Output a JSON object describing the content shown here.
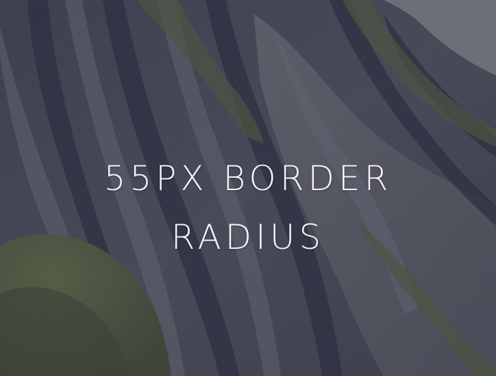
{
  "caption": {
    "line1": "55PX BORDER",
    "line2": "RADIUS"
  },
  "colors": {
    "text": "#f4f4f6",
    "rock_dark": "#2e3042",
    "rock_mid": "#5a5c6a",
    "rock_light": "#8a8c96",
    "grass": "#4e5a3a"
  }
}
